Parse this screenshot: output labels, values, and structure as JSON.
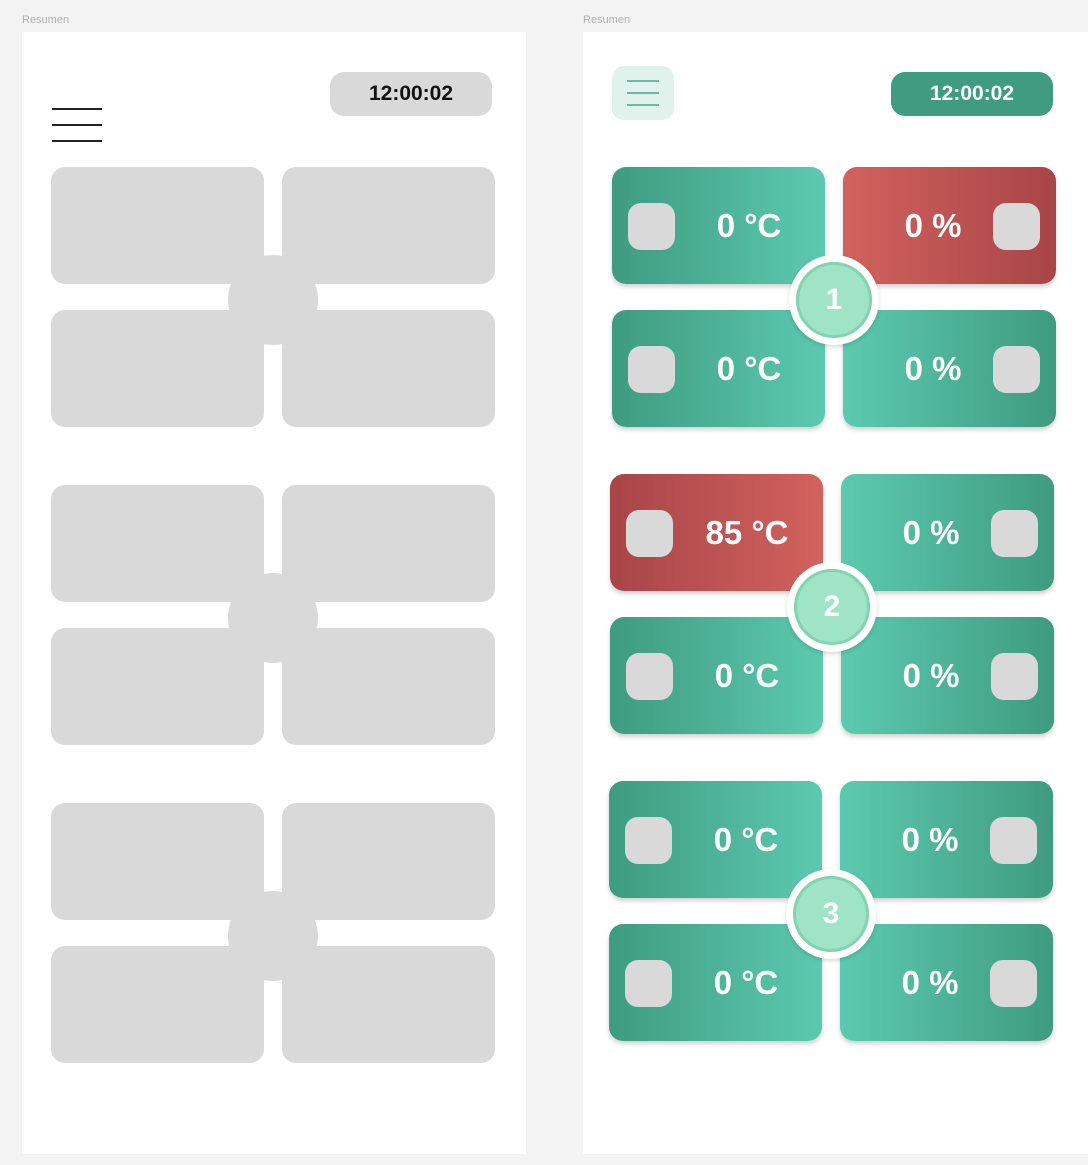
{
  "frames": [
    {
      "label": "Resumen",
      "clock": "12:00:02"
    },
    {
      "label": "Resumen",
      "clock": "12:00:02",
      "groups": [
        {
          "number": "1",
          "tiles": [
            {
              "reading": "0 °C",
              "status": "normal"
            },
            {
              "reading": "0 %",
              "status": "alert"
            },
            {
              "reading": "0 °C",
              "status": "normal"
            },
            {
              "reading": "0 %",
              "status": "normal"
            }
          ]
        },
        {
          "number": "2",
          "tiles": [
            {
              "reading": "85 °C",
              "status": "alert"
            },
            {
              "reading": "0 %",
              "status": "normal"
            },
            {
              "reading": "0 °C",
              "status": "normal"
            },
            {
              "reading": "0 %",
              "status": "normal"
            }
          ]
        },
        {
          "number": "3",
          "tiles": [
            {
              "reading": "0 °C",
              "status": "normal"
            },
            {
              "reading": "0 %",
              "status": "normal"
            },
            {
              "reading": "0 °C",
              "status": "normal"
            },
            {
              "reading": "0 %",
              "status": "normal"
            }
          ]
        }
      ]
    }
  ],
  "colors": {
    "normal": "#4fb398",
    "alert": "#c3575a",
    "wireframe": "#d9d9d9",
    "accent": "#3f9c80",
    "hub": "#9fe4c6"
  }
}
